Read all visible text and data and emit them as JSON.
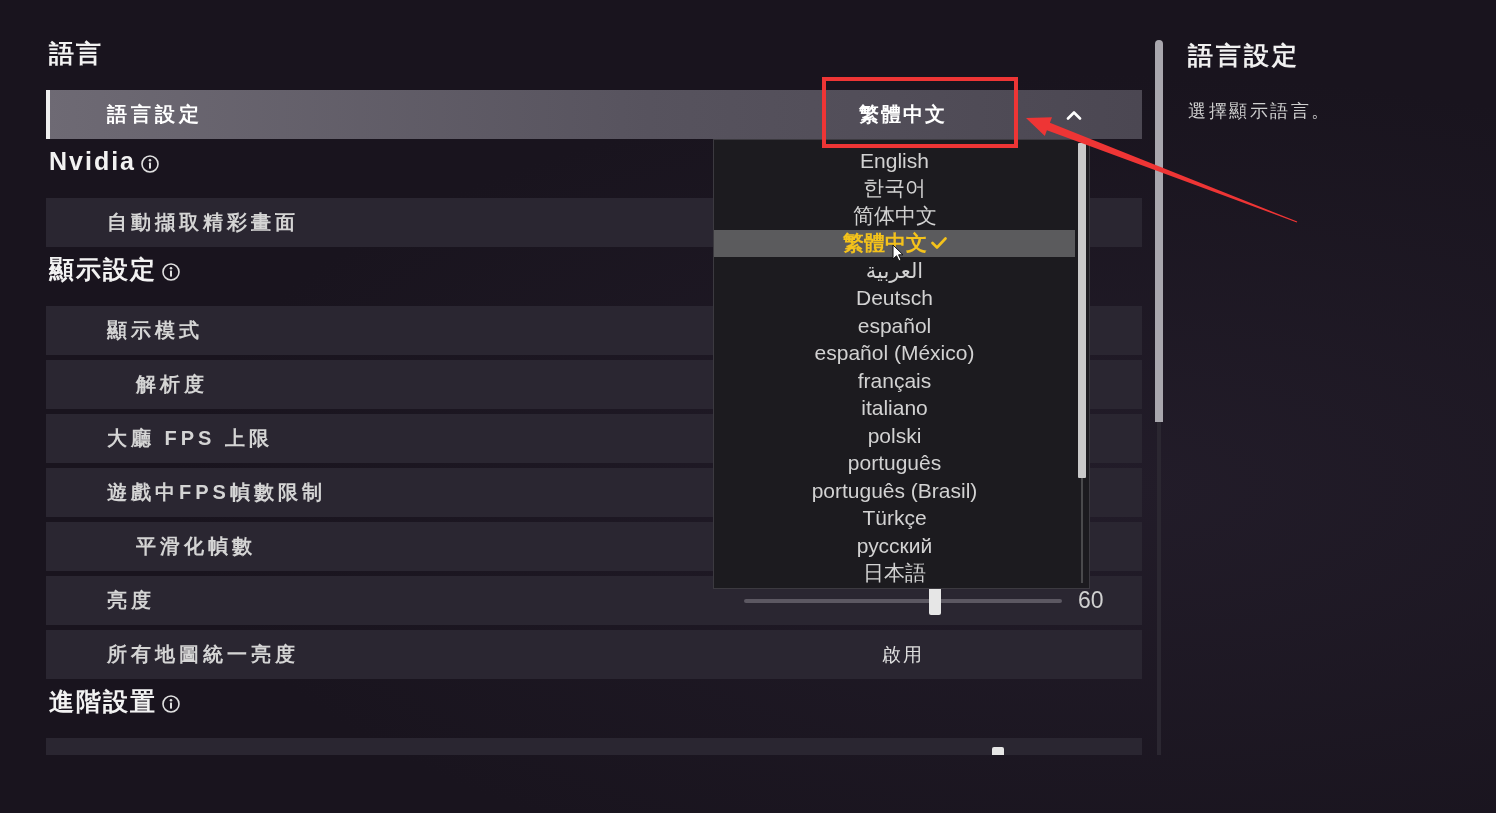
{
  "settings": {
    "sections": [
      {
        "title": "語言",
        "info": false,
        "rows": [
          {
            "kind": "dropdown",
            "label": "語言設定",
            "selected": true,
            "value": "繁體中文",
            "expanded": true,
            "options": [
              {
                "label": "English",
                "selected": false
              },
              {
                "label": "한국어",
                "selected": false
              },
              {
                "label": "简体中文",
                "selected": false
              },
              {
                "label": "繁體中文",
                "selected": true
              },
              {
                "label": "العربية",
                "selected": false
              },
              {
                "label": "Deutsch",
                "selected": false
              },
              {
                "label": "español",
                "selected": false
              },
              {
                "label": "español (México)",
                "selected": false
              },
              {
                "label": "français",
                "selected": false
              },
              {
                "label": "italiano",
                "selected": false
              },
              {
                "label": "polski",
                "selected": false
              },
              {
                "label": "português",
                "selected": false
              },
              {
                "label": "português (Brasil)",
                "selected": false
              },
              {
                "label": "Türkçe",
                "selected": false
              },
              {
                "label": "русский",
                "selected": false
              },
              {
                "label": "日本語",
                "selected": false
              }
            ]
          }
        ]
      },
      {
        "title": "Nvidia",
        "info": true,
        "rows": [
          {
            "kind": "plain",
            "label": "自動擷取精彩畫面",
            "selected": false
          }
        ]
      },
      {
        "title": "顯示設定",
        "info": true,
        "rows": [
          {
            "kind": "plain",
            "label": "顯示模式",
            "selected": false,
            "children": [
              {
                "kind": "plain",
                "label": "解析度",
                "selected": false
              }
            ]
          },
          {
            "kind": "plain",
            "label": "大廳 FPS 上限",
            "selected": false
          },
          {
            "kind": "plain",
            "label": "遊戲中FPS幀數限制",
            "selected": false,
            "children": [
              {
                "kind": "plain",
                "label": "平滑化幀數",
                "selected": false
              }
            ]
          },
          {
            "kind": "slider",
            "label": "亮度",
            "selected": false,
            "level": 0.6,
            "reading": "60"
          },
          {
            "kind": "value",
            "label": "所有地圖統一亮度",
            "selected": false,
            "value": "啟用"
          }
        ]
      },
      {
        "title": "進階設置",
        "info": true,
        "rows": [
          {
            "kind": "slider",
            "selected": false,
            "level": 0.8
          }
        ]
      }
    ]
  },
  "detail": {
    "title": "語言設定",
    "description": "選擇顯示語言。"
  },
  "annotation": {
    "highlight_frame": true,
    "pointer_arrow": true
  }
}
